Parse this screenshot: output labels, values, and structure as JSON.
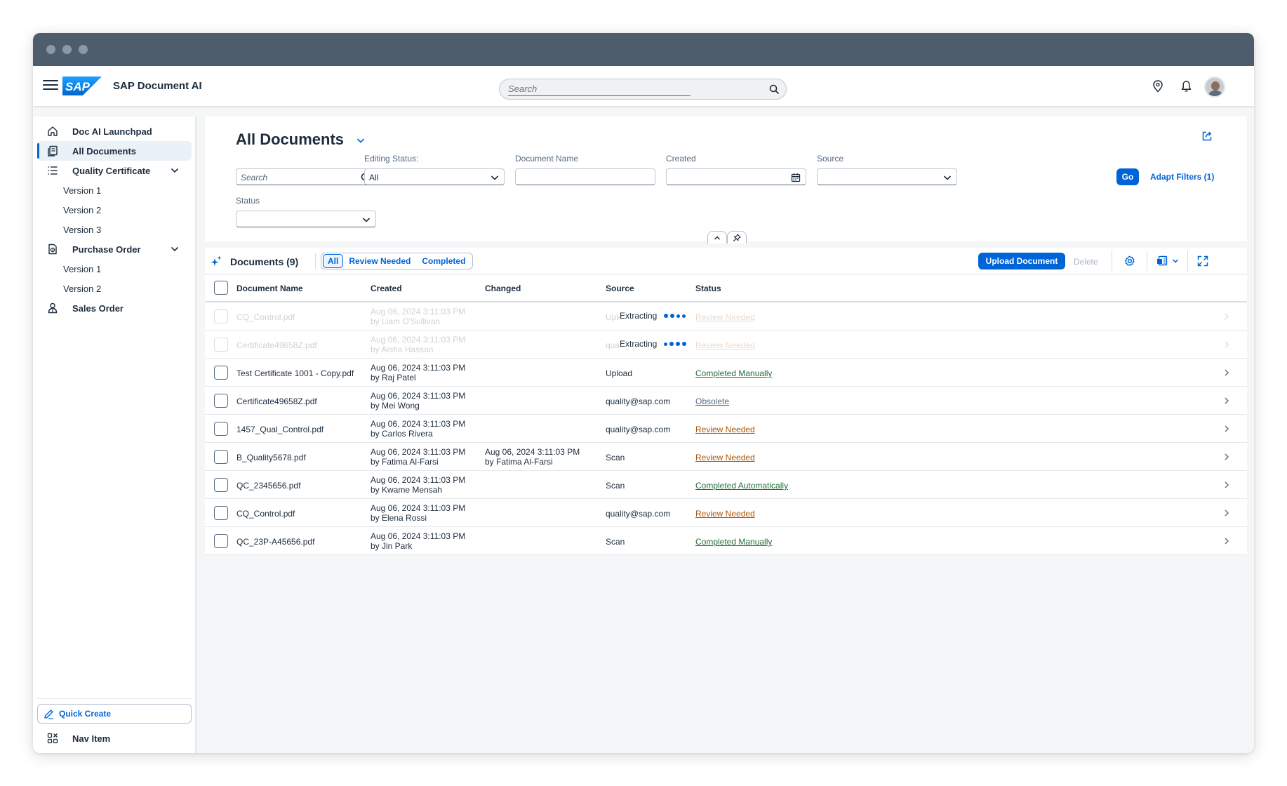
{
  "app": {
    "product_name": "SAP Document AI",
    "logo_text": "SAP"
  },
  "shell": {
    "search_placeholder": "Search"
  },
  "sidenav": {
    "items": [
      {
        "label": "Doc AI Launchpad",
        "icon": "home-icon"
      },
      {
        "label": "All Documents",
        "icon": "documents-icon",
        "selected": true
      },
      {
        "label": "Quality Certificate",
        "icon": "list-icon",
        "expanded": true
      },
      {
        "label": "Version 1"
      },
      {
        "label": "Version 2"
      },
      {
        "label": "Version 3"
      },
      {
        "label": "Purchase Order",
        "icon": "purchase-order-icon",
        "expanded": true
      },
      {
        "label": "Version 1"
      },
      {
        "label": "Version 2"
      },
      {
        "label": "Sales Order",
        "icon": "sales-order-icon"
      }
    ],
    "quick_create": "Quick Create",
    "nav_item": "Nav Item"
  },
  "page": {
    "title": "All Documents",
    "filters": {
      "search_placeholder": "Search",
      "editing_status_label": "Editing Status:",
      "editing_status_value": "All",
      "document_name_label": "Document Name",
      "created_label": "Created",
      "source_label": "Source",
      "status_label": "Status",
      "go": "Go",
      "adapt_filters": "Adapt Filters (1)"
    }
  },
  "table": {
    "title": "Documents (9)",
    "segments": [
      "All",
      "Review Needed",
      "Completed"
    ],
    "active_segment": "All",
    "upload": "Upload Document",
    "delete": "Delete",
    "columns": [
      "Document Name",
      "Created",
      "Changed",
      "Source",
      "Status"
    ],
    "extracting_label": "Extracting",
    "rows": [
      {
        "name": "CQ_Control.pdf",
        "created": "Aug 06, 2024 3:11:03 PM",
        "created_by": "by Liam O'Sullivan",
        "changed": "",
        "changed_by": "",
        "source": "Upload",
        "status": "Review Needed",
        "status_type": "critical",
        "extracting": true
      },
      {
        "name": "Certificate49658Z.pdf",
        "created": "Aug 06, 2024 3:11:03 PM",
        "created_by": "by Aisha Hassan",
        "changed": "",
        "changed_by": "",
        "source": "quality@sap.com",
        "status": "Review Needed",
        "status_type": "critical",
        "extracting": true
      },
      {
        "name": "Test Certificate 1001 - Copy.pdf",
        "created": "Aug 06, 2024 3:11:03 PM",
        "created_by": "by Raj Patel",
        "changed": "",
        "changed_by": "",
        "source": "Upload",
        "status": "Completed Manually",
        "status_type": "positive"
      },
      {
        "name": "Certificate49658Z.pdf",
        "created": "Aug 06, 2024 3:11:03 PM",
        "created_by": "by Mei Wong",
        "changed": "",
        "changed_by": "",
        "source": "quality@sap.com",
        "status": "Obsolete",
        "status_type": "neutral"
      },
      {
        "name": "1457_Qual_Control.pdf",
        "created": "Aug 06, 2024 3:11:03 PM",
        "created_by": "by Carlos Rivera",
        "changed": "",
        "changed_by": "",
        "source": "quality@sap.com",
        "status": "Review Needed",
        "status_type": "critical"
      },
      {
        "name": "B_Quality5678.pdf",
        "created": "Aug 06, 2024 3:11:03 PM",
        "created_by": "by Fatima Al-Farsi",
        "changed": "Aug 06, 2024 3:11:03 PM",
        "changed_by": "by Fatima Al-Farsi",
        "source": "Scan",
        "status": "Review Needed",
        "status_type": "critical"
      },
      {
        "name": "QC_2345656.pdf",
        "created": "Aug 06, 2024 3:11:03 PM",
        "created_by": "by Kwame Mensah",
        "changed": "",
        "changed_by": "",
        "source": "Scan",
        "status": "Completed Automatically",
        "status_type": "positive"
      },
      {
        "name": "CQ_Control.pdf",
        "created": "Aug 06, 2024 3:11:03 PM",
        "created_by": "by Elena Rossi",
        "changed": "",
        "changed_by": "",
        "source": "quality@sap.com",
        "status": "Review Needed",
        "status_type": "critical"
      },
      {
        "name": "QC_23P-A45656.pdf",
        "created": "Aug 06, 2024 3:11:03 PM",
        "created_by": "by Jin Park",
        "changed": "",
        "changed_by": "",
        "source": "Scan",
        "status": "Completed Manually",
        "status_type": "positive"
      }
    ]
  },
  "colors": {
    "accent": "#0064d9",
    "shell_titlebar": "#4e5d6e",
    "positive": "#256f3a",
    "critical": "#aa5808",
    "neutral": "#556b82"
  }
}
